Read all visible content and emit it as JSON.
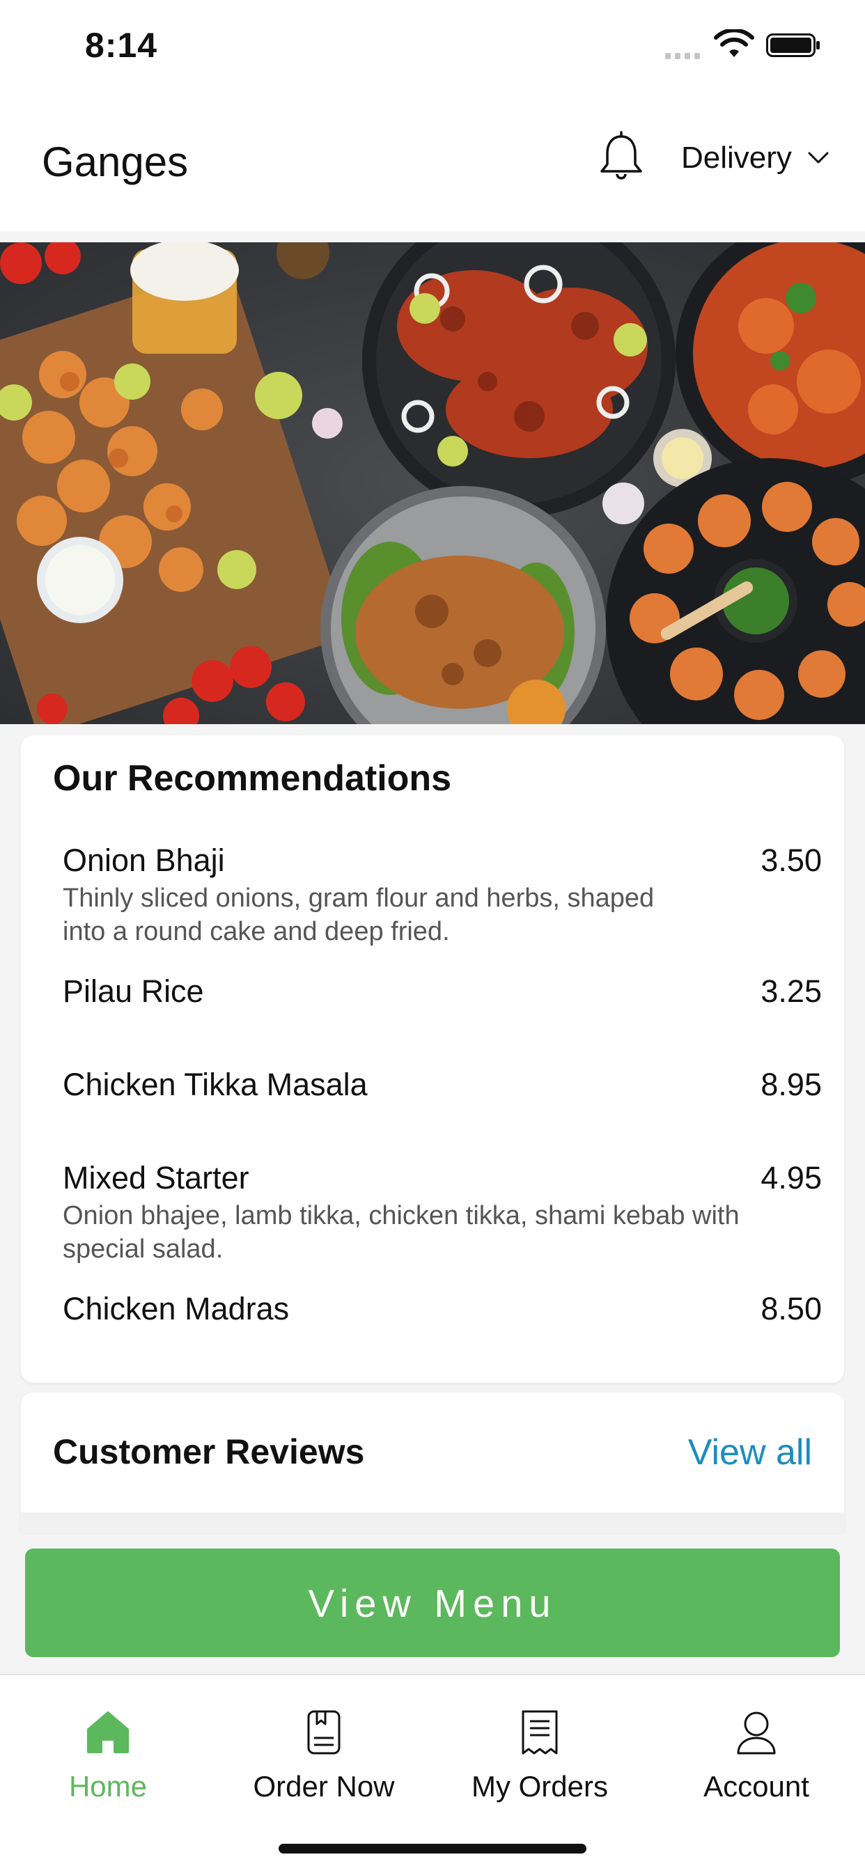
{
  "status_bar": {
    "time": "8:14"
  },
  "header": {
    "app_title": "Ganges",
    "order_mode": "Delivery",
    "bell_icon": "bell-icon",
    "chevron_icon": "chevron-down-icon"
  },
  "recommendations": {
    "title": "Our Recommendations",
    "items": [
      {
        "name": "Onion Bhaji",
        "price": "3.50",
        "description": "Thinly sliced onions, gram flour and herbs, shaped into a round cake and deep fried."
      },
      {
        "name": "Pilau Rice",
        "price": "3.25",
        "description": ""
      },
      {
        "name": "Chicken Tikka Masala",
        "price": "8.95",
        "description": ""
      },
      {
        "name": "Mixed Starter",
        "price": "4.95",
        "description": "Onion bhajee, lamb tikka, chicken tikka, shami kebab with special salad."
      },
      {
        "name": "Chicken Madras",
        "price": "8.50",
        "description": ""
      }
    ]
  },
  "reviews": {
    "title": "Customer Reviews",
    "view_all": "View all"
  },
  "cta": {
    "label": "View Menu"
  },
  "tabs": [
    {
      "label": "Home",
      "icon": "home-icon",
      "active": true
    },
    {
      "label": "Order Now",
      "icon": "order-icon",
      "active": false
    },
    {
      "label": "My Orders",
      "icon": "receipt-icon",
      "active": false
    },
    {
      "label": "Account",
      "icon": "user-icon",
      "active": false
    }
  ],
  "colors": {
    "accent_green": "#5cb85c",
    "link_blue": "#1b8dc0"
  }
}
